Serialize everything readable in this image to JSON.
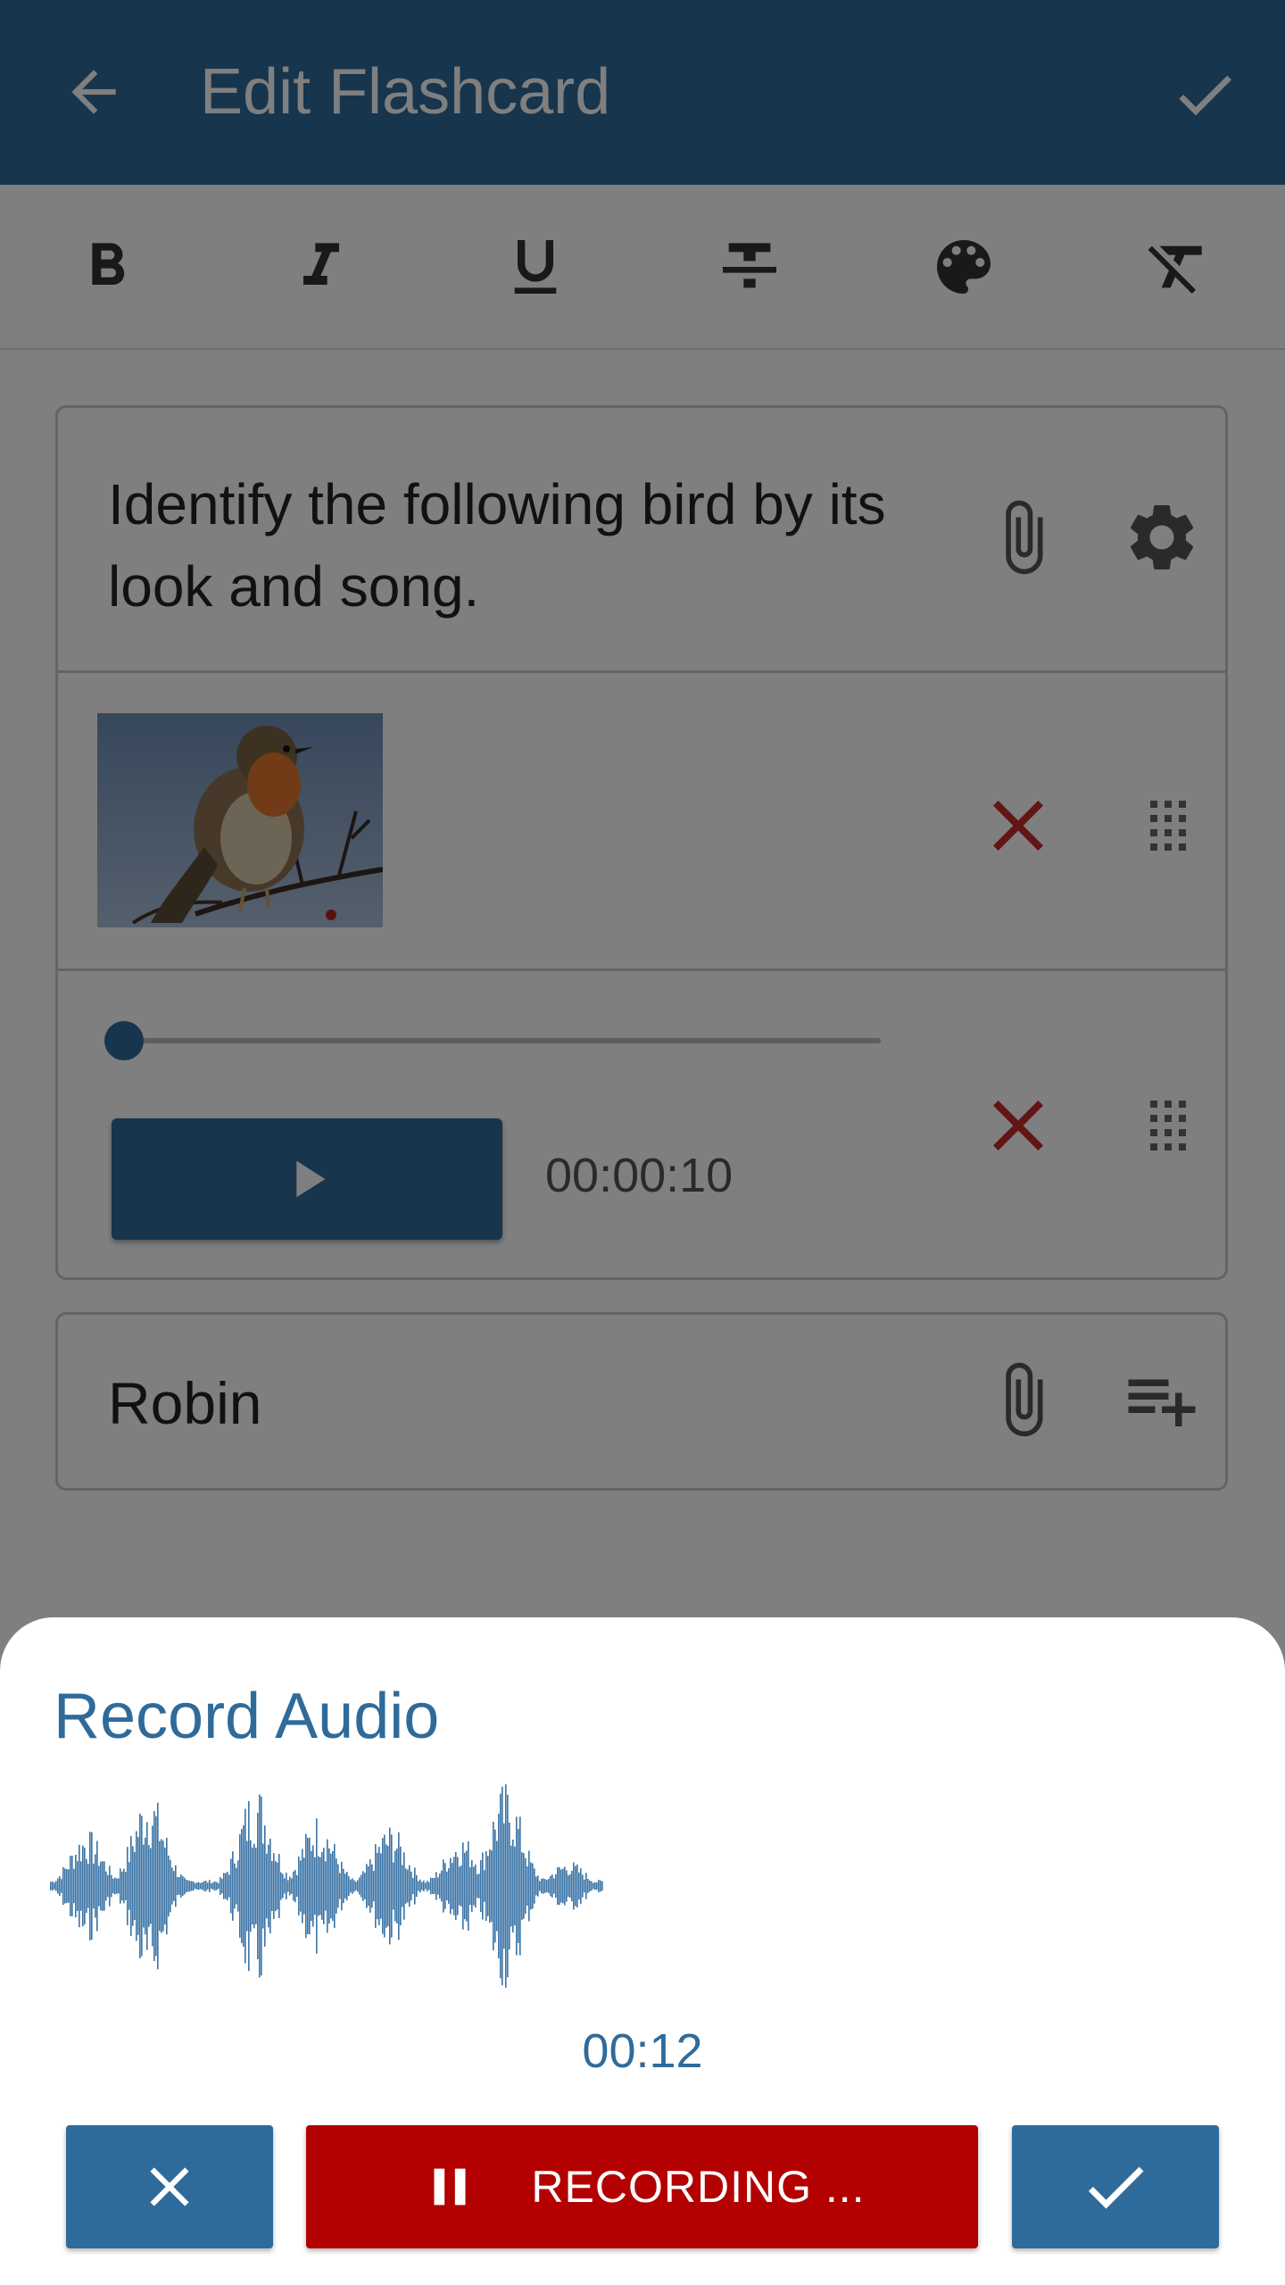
{
  "app_bar": {
    "title": "Edit Flashcard",
    "back_icon": "arrow-left-icon",
    "save_icon": "check-icon"
  },
  "toolbar": {
    "items": [
      "bold-icon",
      "italic-icon",
      "underline-icon",
      "strikethrough-icon",
      "palette-icon",
      "clear-format-icon"
    ]
  },
  "question_card": {
    "text": "Identify the following bird by its look and song.",
    "image_item": {
      "icon_remove": "close-icon",
      "icon_drag": "drag-handle-icon"
    },
    "audio_item": {
      "time": "00:00:10",
      "progress": 0.0
    }
  },
  "answer_card": {
    "text": "Robin"
  },
  "record_sheet": {
    "title": "Record Audio",
    "elapsed": "00:12",
    "cancel_icon": "close-icon",
    "record_label": "RECORDING ...",
    "confirm_icon": "check-icon"
  },
  "colors": {
    "primary": "#2f6b9a",
    "record_red": "#b30000",
    "delete_red": "#c62828",
    "scrim": "rgba(0,0,0,0.5)"
  }
}
